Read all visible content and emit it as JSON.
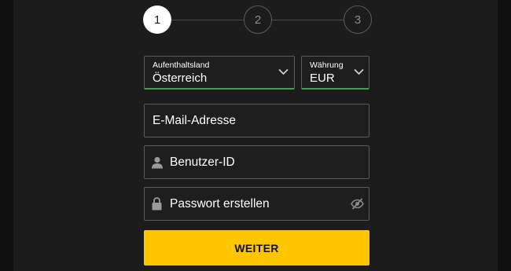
{
  "stepper": {
    "steps": [
      {
        "label": "1",
        "state": "active"
      },
      {
        "label": "2",
        "state": "inactive"
      },
      {
        "label": "3",
        "state": "inactive"
      }
    ]
  },
  "form": {
    "country": {
      "label": "Aufenthaltsland",
      "value": "Österreich"
    },
    "currency": {
      "label": "Währung",
      "value": "EUR"
    },
    "email": {
      "placeholder": "E-Mail-Adresse"
    },
    "username": {
      "placeholder": "Benutzer-ID",
      "icon": "user-icon"
    },
    "password": {
      "placeholder": "Passwort erstellen",
      "icon": "lock-icon",
      "toggle_icon": "eye-slash-icon"
    },
    "submit_label": "WEITER"
  },
  "colors": {
    "accent": "#ffc600",
    "valid_underline": "#3aa64a",
    "panel": "#1c1c1c",
    "page": "#0f0f0f"
  }
}
